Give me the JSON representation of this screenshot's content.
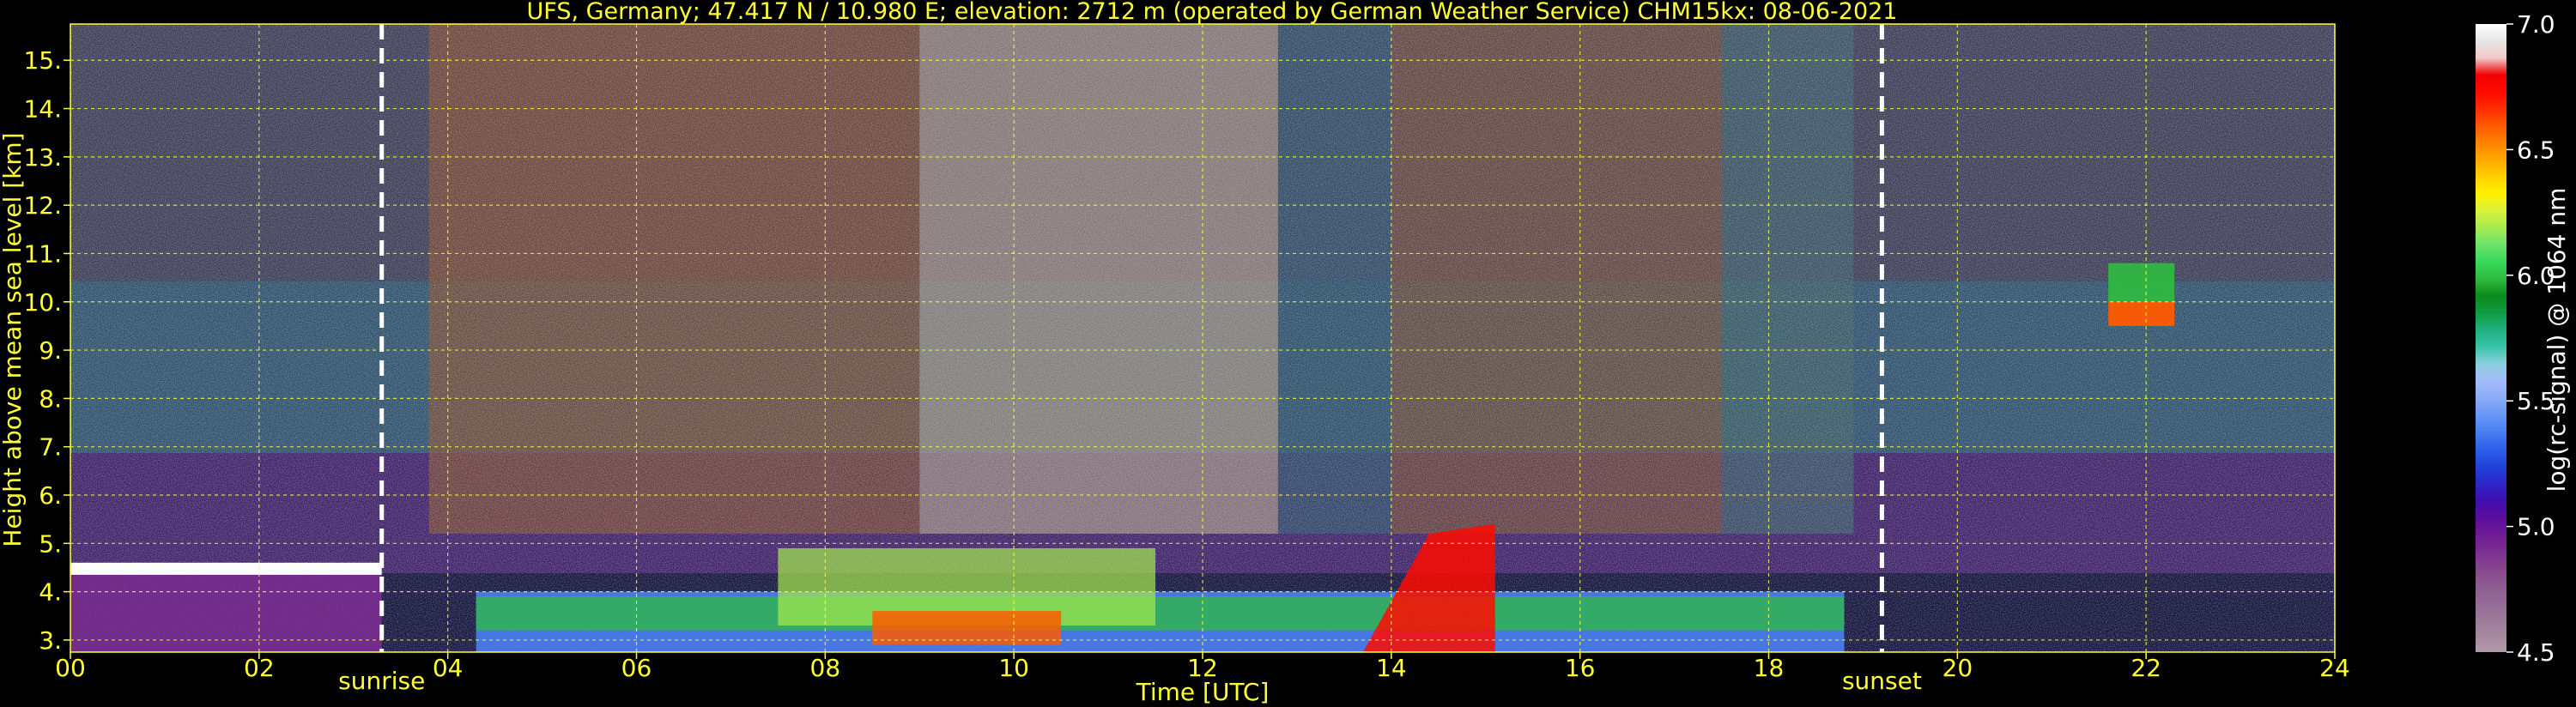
{
  "chart_data": {
    "type": "heatmap",
    "title": "UFS, Germany; 47.417 N / 10.980 E; elevation: 2712 m  (operated by German Weather Service)    CHM15kx: 08-06-2021",
    "xlabel": "Time [UTC]",
    "ylabel": "Height above mean sea level [km]",
    "xlim": [
      0,
      24
    ],
    "ylim": [
      2.75,
      15.75
    ],
    "x_ticks": [
      "00",
      "02",
      "04",
      "06",
      "08",
      "10",
      "12",
      "14",
      "16",
      "18",
      "20",
      "22",
      "24"
    ],
    "x_tick_values": [
      0,
      2,
      4,
      6,
      8,
      10,
      12,
      14,
      16,
      18,
      20,
      22,
      24
    ],
    "y_ticks": [
      "3.",
      "4.",
      "5.",
      "6.",
      "7.",
      "8.",
      "9.",
      "10.",
      "11.",
      "12.",
      "13.",
      "14.",
      "15."
    ],
    "y_tick_values": [
      3,
      4,
      5,
      6,
      7,
      8,
      9,
      10,
      11,
      12,
      13,
      14,
      15
    ],
    "grid": true,
    "events": [
      {
        "label": "sunrise",
        "time": 3.3
      },
      {
        "label": "sunset",
        "time": 19.2
      }
    ],
    "colorbar": {
      "label": "log(rc-signal) @ 1064 nm",
      "range": [
        4.5,
        7.0
      ],
      "ticks": [
        "4.5",
        "5.0",
        "5.5",
        "6.0",
        "6.5",
        "7.0"
      ],
      "tick_values": [
        4.5,
        5.0,
        5.5,
        6.0,
        6.5,
        7.0
      ],
      "colors": [
        "#b09aa8",
        "#a6889f",
        "#9c7899",
        "#946996",
        "#8d5a92",
        "#86448f",
        "#7b2e90",
        "#6c1a95",
        "#5a0c9e",
        "#3e10b2",
        "#2a28c8",
        "#2244dd",
        "#2d62ea",
        "#4a80f3",
        "#6b98f6",
        "#8aacf8",
        "#a4bcf9",
        "#8ad0dc",
        "#35c3a8",
        "#1fb07f",
        "#0f9b40",
        "#0e8a1c",
        "#2fbc3f",
        "#37d85a",
        "#6de26a",
        "#a5ea4d",
        "#d8f23c",
        "#fff200",
        "#ffd000",
        "#ffa900",
        "#ff8200",
        "#ff5a00",
        "#ff2d00",
        "#ff0a00",
        "#f00000",
        "#f2c8c8",
        "#e6e6e6",
        "#ffffff"
      ]
    },
    "features": [
      {
        "kind": "cloud-layer",
        "t_start": 0.0,
        "t_end": 3.3,
        "height_km": 4.5,
        "value": 7.0
      },
      {
        "kind": "boundary-layer",
        "t_start": 4.3,
        "t_end": 18.8,
        "height_top_km": 4.9,
        "value_peak": 6.6
      },
      {
        "kind": "convective-plume",
        "t_start": 14.4,
        "t_end": 15.1,
        "height_top_km": 5.4,
        "value_peak": 6.7
      },
      {
        "kind": "elevated-layer",
        "t_start": 21.6,
        "t_end": 22.3,
        "height_km": 10.0,
        "value_peak": 6.6
      }
    ]
  }
}
